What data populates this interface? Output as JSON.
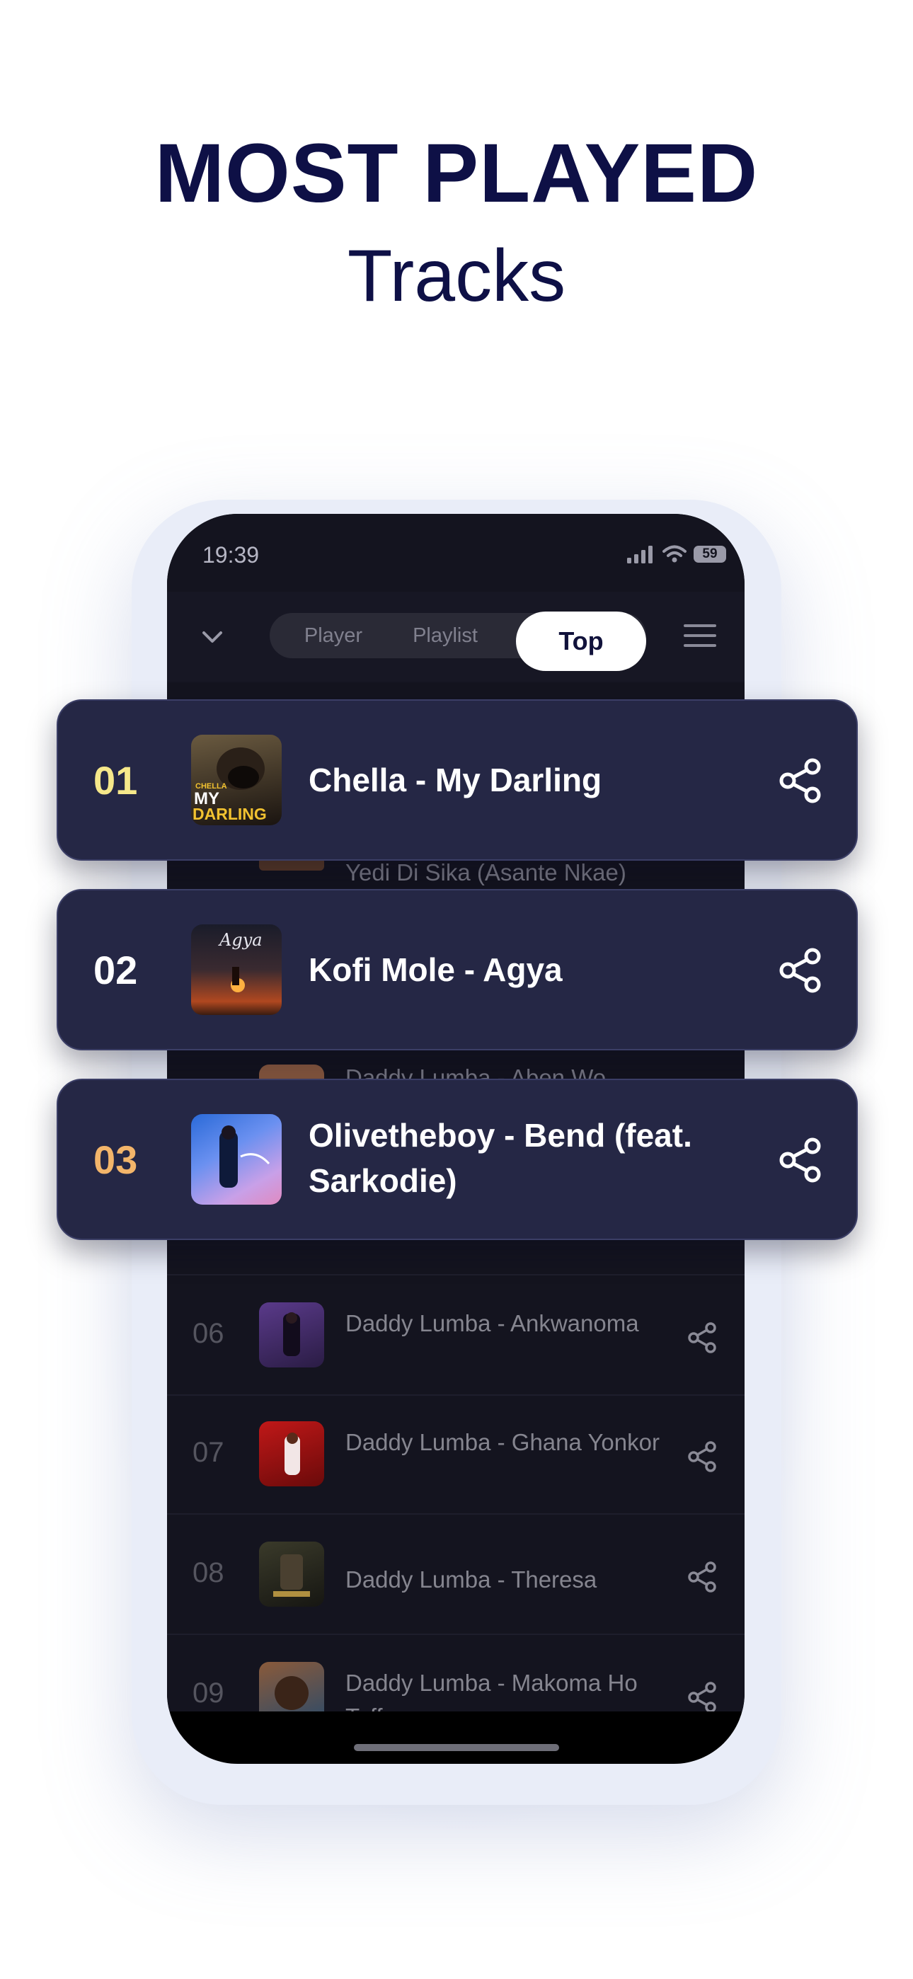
{
  "hero": {
    "title": "MOST PLAYED",
    "subtitle": "Tracks"
  },
  "status_bar": {
    "time": "19:39",
    "battery": "59"
  },
  "tabs": [
    {
      "label": "Player",
      "active": false
    },
    {
      "label": "Playlist",
      "active": false
    },
    {
      "label": "Top",
      "active": true
    }
  ],
  "featured": [
    {
      "rank": "01",
      "title": "Chella - My Darling",
      "rank_color": "#f6e88a",
      "art_text_top": "CHELLA",
      "art_text_mid": "MY",
      "art_text_bottom": "DARLING"
    },
    {
      "rank": "02",
      "title": "Kofi Mole - Agya",
      "rank_color": "#ffffff",
      "art_text_top": "Agya"
    },
    {
      "rank": "03",
      "title": "Olivetheboy - Bend (feat. Sarkodie)",
      "rank_color": "#f3b56a"
    }
  ],
  "partial_rows": [
    {
      "title": "Yedi Di Sika (Asante Nkae)"
    },
    {
      "title": "Daddy Lumba  -  Aben Wo"
    }
  ],
  "list": [
    {
      "rank": "06",
      "title": "Daddy Lumba  -  Ankwanoma"
    },
    {
      "rank": "07",
      "title": "Daddy Lumba  -  Ghana Yonkor"
    },
    {
      "rank": "08",
      "title": "Daddy Lumba  -  Theresa"
    },
    {
      "rank": "09",
      "title": "Daddy Lumba  -  Makoma Ho Toffee"
    }
  ],
  "icons": {
    "collapse": "chevron-down-icon",
    "menu": "hamburger-menu-icon",
    "share": "share-icon"
  },
  "colors": {
    "brand_navy": "#0e1046",
    "card_bg": "#252745",
    "screen_bg": "#14141f"
  }
}
